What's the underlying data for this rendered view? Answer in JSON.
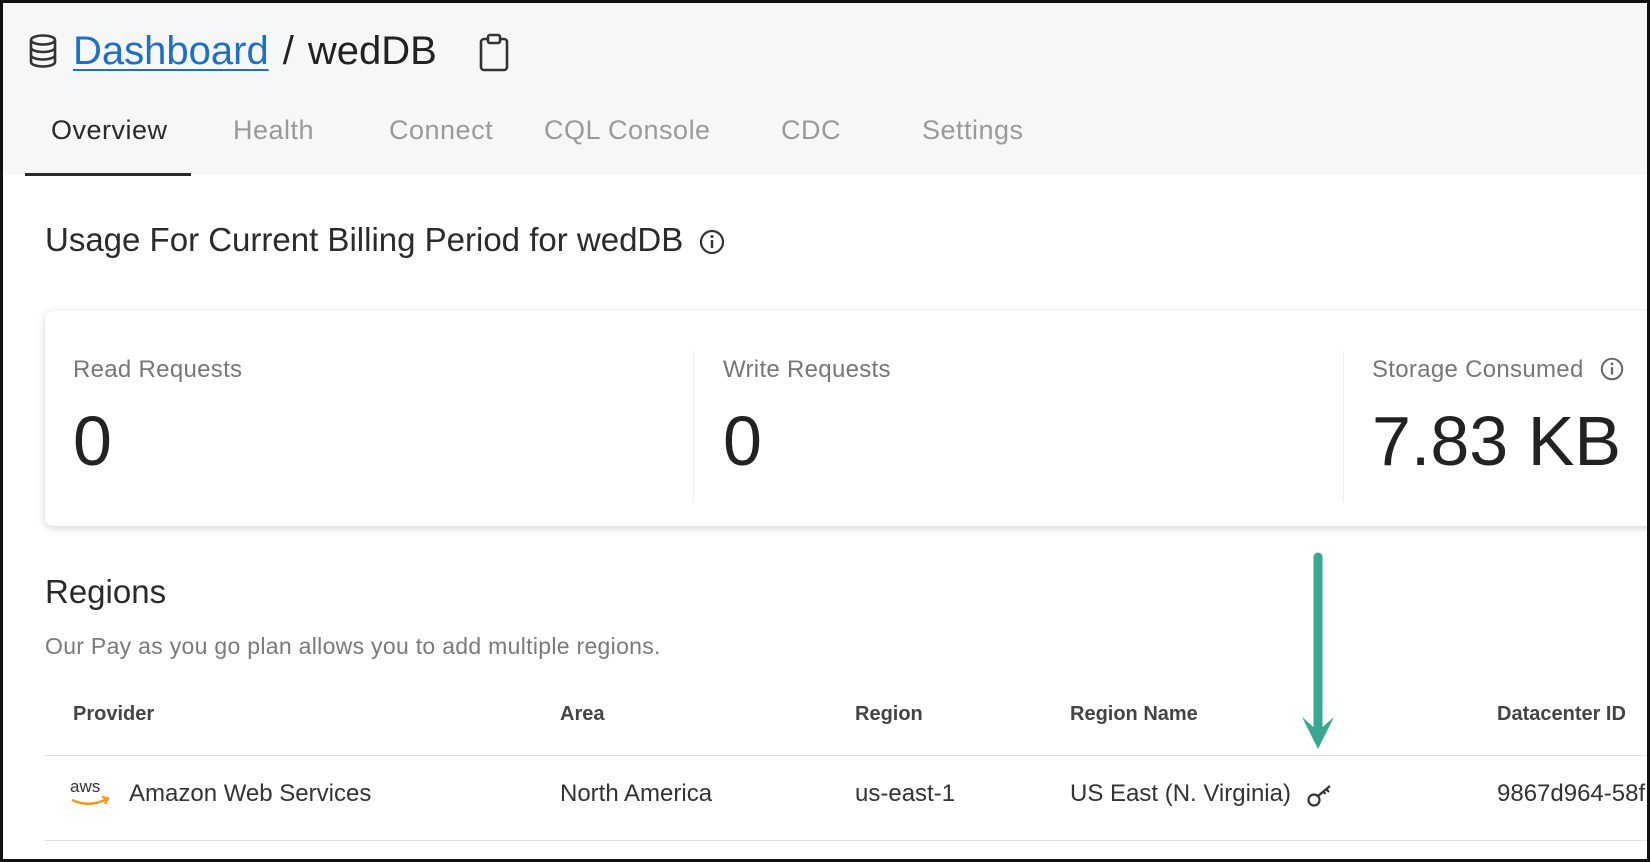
{
  "breadcrumb": {
    "root_label": "Dashboard",
    "separator": "/",
    "current": "wedDB"
  },
  "tabs": [
    {
      "label": "Overview",
      "active": true
    },
    {
      "label": "Health",
      "active": false
    },
    {
      "label": "Connect",
      "active": false
    },
    {
      "label": "CQL Console",
      "active": false
    },
    {
      "label": "CDC",
      "active": false
    },
    {
      "label": "Settings",
      "active": false
    }
  ],
  "usage": {
    "title": "Usage For Current Billing Period for wedDB",
    "metrics": [
      {
        "label": "Read Requests",
        "value": "0"
      },
      {
        "label": "Write Requests",
        "value": "0"
      },
      {
        "label": "Storage Consumed",
        "value": "7.83 KB"
      }
    ]
  },
  "regions": {
    "title": "Regions",
    "subtitle": "Our Pay as you go plan allows you to add multiple regions.",
    "columns": [
      "Provider",
      "Area",
      "Region",
      "Region Name",
      "Datacenter ID"
    ],
    "rows": [
      {
        "provider_logo": "aws",
        "provider": "Amazon Web Services",
        "area": "North America",
        "region": "us-east-1",
        "region_name": "US East (N. Virginia)",
        "datacenter_id": "9867d964-58f"
      }
    ]
  },
  "icons": {
    "database": "database-icon",
    "clipboard": "clipboard-icon",
    "info": "info-icon",
    "key": "key-icon",
    "arrow": "arrow-down-annotation"
  },
  "colors": {
    "link": "#1f6fc5",
    "arrow": "#3aa890",
    "header_bg": "#f6f7f8"
  }
}
